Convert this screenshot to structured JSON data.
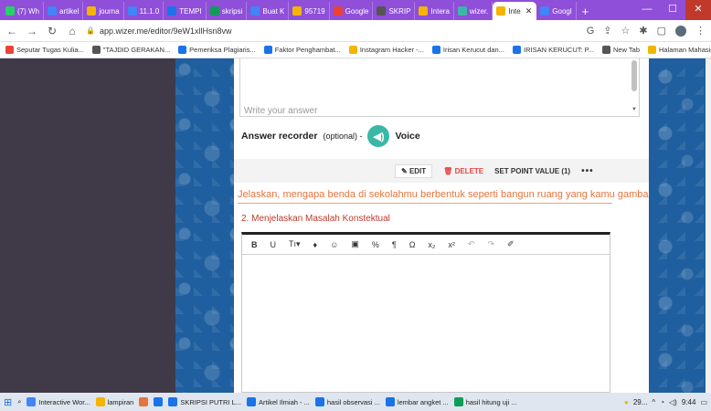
{
  "browser": {
    "tabs": [
      {
        "label": "(7) Wh",
        "color": "#25d366",
        "active": false
      },
      {
        "label": "artikel",
        "color": "#4285f4",
        "active": false
      },
      {
        "label": "journa",
        "color": "#f4b400",
        "active": false
      },
      {
        "label": "11.1.0",
        "color": "#4285f4",
        "active": false
      },
      {
        "label": "TEMPI",
        "color": "#1a73e8",
        "active": false
      },
      {
        "label": "skripsi",
        "color": "#0f9d58",
        "active": false
      },
      {
        "label": "Buat K",
        "color": "#4285f4",
        "active": false
      },
      {
        "label": "95719",
        "color": "#f4b400",
        "active": false
      },
      {
        "label": "Google",
        "color": "#ea4335",
        "active": false
      },
      {
        "label": "SKRIP",
        "color": "#555555",
        "active": false
      },
      {
        "label": "Intera",
        "color": "#f4b400",
        "active": false
      },
      {
        "label": "wizer.",
        "color": "#3bb7a6",
        "active": false
      },
      {
        "label": "Inte",
        "color": "#f4b400",
        "active": true
      },
      {
        "label": "Googl",
        "color": "#4285f4",
        "active": false
      }
    ],
    "new_tab": "+",
    "url": "app.wizer.me/editor/9eW1xllHsn8vw",
    "bookmarks": [
      {
        "label": "Seputar Tugas Kulia...",
        "color": "#ea4335"
      },
      {
        "label": "\"TAJDID GERAKAN...",
        "color": "#555555"
      },
      {
        "label": "Pemeriksa Plagiaris...",
        "color": "#1a73e8"
      },
      {
        "label": "Faktor Penghambat...",
        "color": "#1a73e8"
      },
      {
        "label": "Instagram Hacker -...",
        "color": "#f4b400"
      },
      {
        "label": "Irisan Kerucut dan...",
        "color": "#1a73e8"
      },
      {
        "label": "IRISAN KERUCUT: P...",
        "color": "#1a73e8"
      },
      {
        "label": "New Tab",
        "color": "#555555"
      },
      {
        "label": "Halaman Mahasisw...",
        "color": "#f4b400"
      }
    ],
    "bookmarks_more": "»"
  },
  "editor": {
    "answer_placeholder": "Write your answer",
    "recorder_label": "Answer recorder",
    "recorder_optional": "(optional) -",
    "voice_label": "Voice",
    "edit_label": "EDIT",
    "delete_label": "DELETE",
    "point_value_label": "SET POINT VALUE (1)",
    "more_label": "•••",
    "question_text": "Jelaskan, mengapa benda di sekolahmu berbentuk seperti bangun ruang yang kamu gambar !",
    "section_title": "2. Menjelaskan Masalah Konstektual",
    "toolbar": [
      "B",
      "U",
      "Tı▾",
      "♦",
      "☺",
      "▣",
      "%",
      "¶",
      "Ω",
      "x₂",
      "x²",
      "↶",
      "↷",
      "✐"
    ]
  },
  "taskbar": {
    "items": [
      {
        "label": "Interactive Wor...",
        "color": "#4285f4"
      },
      {
        "label": "lampiran",
        "color": "#f4b400"
      },
      {
        "label": "",
        "color": "#e6743b"
      },
      {
        "label": "",
        "color": "#1a73e8"
      },
      {
        "label": "SKRIPSI PUTRI L...",
        "color": "#1a73e8"
      },
      {
        "label": "Artikel Ilmiah - ...",
        "color": "#1a73e8"
      },
      {
        "label": "hasil observasi ...",
        "color": "#1a73e8"
      },
      {
        "label": "lembar angket ...",
        "color": "#1a73e8"
      },
      {
        "label": "hasil hitung uji ...",
        "color": "#0f9d58"
      }
    ],
    "weather": "29...",
    "time": "9:44"
  }
}
